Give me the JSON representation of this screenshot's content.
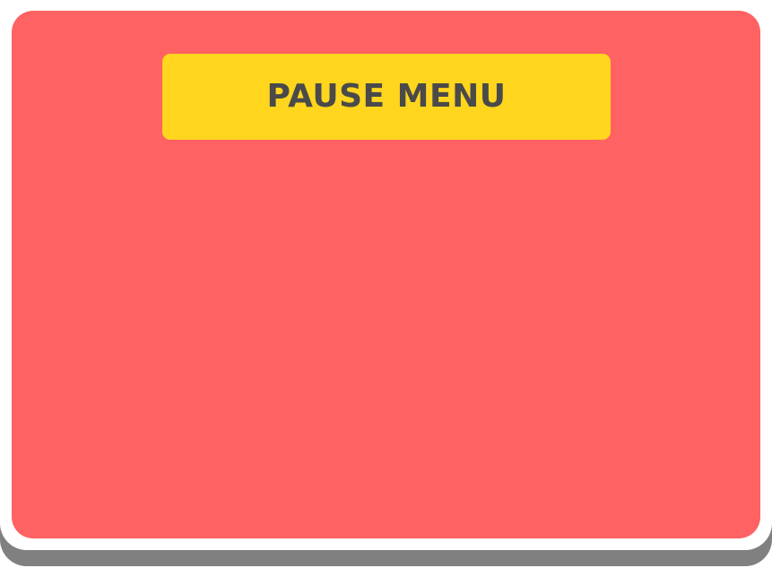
{
  "pause_menu": {
    "title": "PAUSE MENU"
  },
  "colors": {
    "panel": "#FF6262",
    "panel_border": "#FFFFFF",
    "panel_shadow": "#808080",
    "banner": "#FFD61D",
    "title_text": "#4A4A4A"
  }
}
